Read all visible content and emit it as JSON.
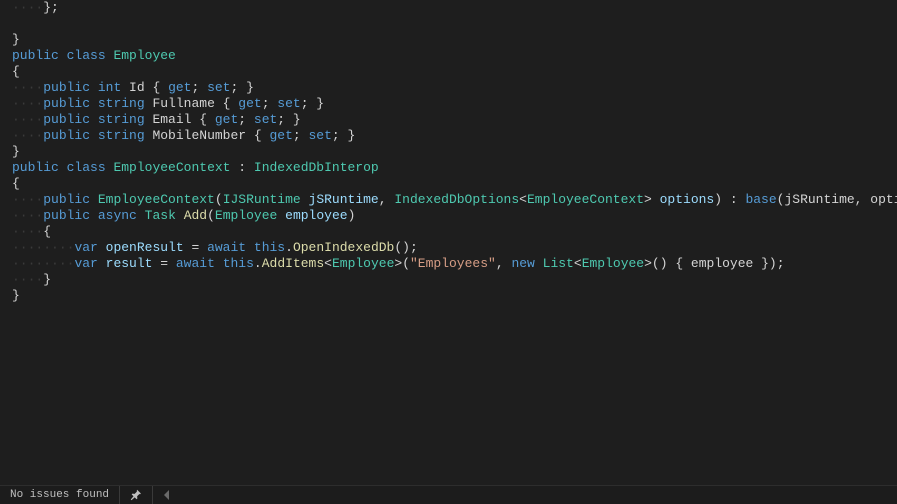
{
  "code": {
    "lines": [
      {
        "indent": 1,
        "segs": [
          {
            "c": "p",
            "t": "};"
          }
        ]
      },
      {
        "indent": 0,
        "segs": []
      },
      {
        "indent": 0,
        "segs": [
          {
            "c": "p",
            "t": "}"
          }
        ]
      },
      {
        "indent": 0,
        "segs": [
          {
            "c": "k",
            "t": "public"
          },
          {
            "c": "p",
            "t": " "
          },
          {
            "c": "k",
            "t": "class"
          },
          {
            "c": "p",
            "t": " "
          },
          {
            "c": "t",
            "t": "Employee"
          }
        ]
      },
      {
        "indent": 0,
        "segs": [
          {
            "c": "p",
            "t": "{"
          }
        ]
      },
      {
        "indent": 1,
        "segs": [
          {
            "c": "k",
            "t": "public"
          },
          {
            "c": "p",
            "t": " "
          },
          {
            "c": "k",
            "t": "int"
          },
          {
            "c": "p",
            "t": " Id { "
          },
          {
            "c": "k",
            "t": "get"
          },
          {
            "c": "p",
            "t": "; "
          },
          {
            "c": "k",
            "t": "set"
          },
          {
            "c": "p",
            "t": "; }"
          }
        ]
      },
      {
        "indent": 1,
        "segs": [
          {
            "c": "k",
            "t": "public"
          },
          {
            "c": "p",
            "t": " "
          },
          {
            "c": "k",
            "t": "string"
          },
          {
            "c": "p",
            "t": " Fullname { "
          },
          {
            "c": "k",
            "t": "get"
          },
          {
            "c": "p",
            "t": "; "
          },
          {
            "c": "k",
            "t": "set"
          },
          {
            "c": "p",
            "t": "; }"
          }
        ]
      },
      {
        "indent": 1,
        "segs": [
          {
            "c": "k",
            "t": "public"
          },
          {
            "c": "p",
            "t": " "
          },
          {
            "c": "k",
            "t": "string"
          },
          {
            "c": "p",
            "t": " Email { "
          },
          {
            "c": "k",
            "t": "get"
          },
          {
            "c": "p",
            "t": "; "
          },
          {
            "c": "k",
            "t": "set"
          },
          {
            "c": "p",
            "t": "; }"
          }
        ]
      },
      {
        "indent": 1,
        "segs": [
          {
            "c": "k",
            "t": "public"
          },
          {
            "c": "p",
            "t": " "
          },
          {
            "c": "k",
            "t": "string"
          },
          {
            "c": "p",
            "t": " MobileNumber { "
          },
          {
            "c": "k",
            "t": "get"
          },
          {
            "c": "p",
            "t": "; "
          },
          {
            "c": "k",
            "t": "set"
          },
          {
            "c": "p",
            "t": "; }"
          }
        ]
      },
      {
        "indent": 0,
        "segs": [
          {
            "c": "p",
            "t": "}"
          }
        ]
      },
      {
        "indent": 0,
        "segs": [
          {
            "c": "k",
            "t": "public"
          },
          {
            "c": "p",
            "t": " "
          },
          {
            "c": "k",
            "t": "class"
          },
          {
            "c": "p",
            "t": " "
          },
          {
            "c": "t",
            "t": "EmployeeContext"
          },
          {
            "c": "p",
            "t": " : "
          },
          {
            "c": "t",
            "t": "IndexedDbInterop"
          }
        ]
      },
      {
        "indent": 0,
        "segs": [
          {
            "c": "p",
            "t": "{"
          }
        ]
      },
      {
        "indent": 1,
        "segs": [
          {
            "c": "k",
            "t": "public"
          },
          {
            "c": "p",
            "t": " "
          },
          {
            "c": "t",
            "t": "EmployeeContext"
          },
          {
            "c": "p",
            "t": "("
          },
          {
            "c": "t",
            "t": "IJSRuntime"
          },
          {
            "c": "p",
            "t": " "
          },
          {
            "c": "v",
            "t": "jSRuntime"
          },
          {
            "c": "p",
            "t": ", "
          },
          {
            "c": "t",
            "t": "IndexedDbOptions"
          },
          {
            "c": "p",
            "t": "<"
          },
          {
            "c": "t",
            "t": "EmployeeContext"
          },
          {
            "c": "p",
            "t": "> "
          },
          {
            "c": "v",
            "t": "options"
          },
          {
            "c": "p",
            "t": ") : "
          },
          {
            "c": "k",
            "t": "base"
          },
          {
            "c": "p",
            "t": "(jSRuntime, options) { }"
          }
        ]
      },
      {
        "indent": 1,
        "segs": [
          {
            "c": "k",
            "t": "public"
          },
          {
            "c": "p",
            "t": " "
          },
          {
            "c": "k",
            "t": "async"
          },
          {
            "c": "p",
            "t": " "
          },
          {
            "c": "t",
            "t": "Task"
          },
          {
            "c": "p",
            "t": " "
          },
          {
            "c": "m",
            "t": "Add"
          },
          {
            "c": "p",
            "t": "("
          },
          {
            "c": "t",
            "t": "Employee"
          },
          {
            "c": "p",
            "t": " "
          },
          {
            "c": "v",
            "t": "employee"
          },
          {
            "c": "p",
            "t": ")"
          }
        ]
      },
      {
        "indent": 1,
        "segs": [
          {
            "c": "p",
            "t": "{"
          }
        ]
      },
      {
        "indent": 2,
        "segs": [
          {
            "c": "k",
            "t": "var"
          },
          {
            "c": "p",
            "t": " "
          },
          {
            "c": "v",
            "t": "openResult"
          },
          {
            "c": "p",
            "t": " = "
          },
          {
            "c": "k",
            "t": "await"
          },
          {
            "c": "p",
            "t": " "
          },
          {
            "c": "k",
            "t": "this"
          },
          {
            "c": "p",
            "t": "."
          },
          {
            "c": "m",
            "t": "OpenIndexedDb"
          },
          {
            "c": "p",
            "t": "();"
          }
        ]
      },
      {
        "indent": 2,
        "segs": [
          {
            "c": "k",
            "t": "var"
          },
          {
            "c": "p",
            "t": " "
          },
          {
            "c": "v",
            "t": "result"
          },
          {
            "c": "p",
            "t": " = "
          },
          {
            "c": "k",
            "t": "await"
          },
          {
            "c": "p",
            "t": " "
          },
          {
            "c": "k",
            "t": "this"
          },
          {
            "c": "p",
            "t": "."
          },
          {
            "c": "m",
            "t": "AddItems"
          },
          {
            "c": "p",
            "t": "<"
          },
          {
            "c": "t",
            "t": "Employee"
          },
          {
            "c": "p",
            "t": ">("
          },
          {
            "c": "s",
            "t": "\"Employees\""
          },
          {
            "c": "p",
            "t": ", "
          },
          {
            "c": "k",
            "t": "new"
          },
          {
            "c": "p",
            "t": " "
          },
          {
            "c": "t",
            "t": "List"
          },
          {
            "c": "p",
            "t": "<"
          },
          {
            "c": "t",
            "t": "Employee"
          },
          {
            "c": "p",
            "t": ">() { employee });"
          }
        ]
      },
      {
        "indent": 1,
        "segs": [
          {
            "c": "p",
            "t": "}"
          }
        ]
      },
      {
        "indent": 0,
        "segs": [
          {
            "c": "p",
            "t": "}"
          }
        ]
      }
    ],
    "indent_unit": "····"
  },
  "status": {
    "issues": "No issues found"
  }
}
